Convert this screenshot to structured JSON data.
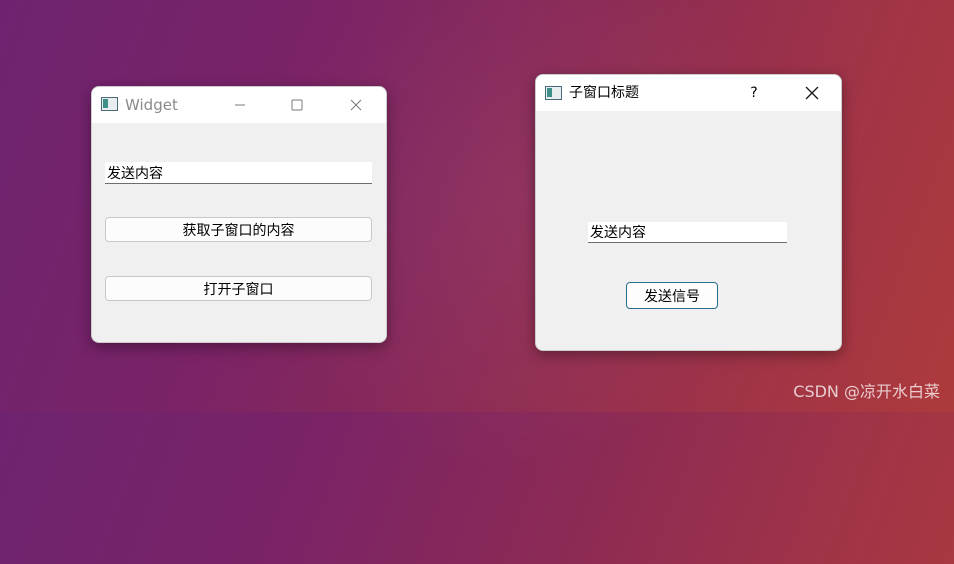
{
  "widget_window": {
    "title": "Widget",
    "line_edit_value": "发送内容",
    "get_child_button": "获取子窗口的内容",
    "open_child_button": "打开子窗口"
  },
  "child_dialog": {
    "title": "子窗口标题",
    "help_glyph": "?",
    "line_edit_value": "发送内容",
    "send_signal_button": "发送信号"
  },
  "watermark": "CSDN @凉开水白菜",
  "icons": {
    "app": "app-window-icon",
    "minimize": "minimize-icon",
    "maximize": "maximize-icon",
    "close": "close-icon",
    "help": "help-icon"
  },
  "colors": {
    "window_bg": "#f0f0f0",
    "titlebar_bg": "#ffffff",
    "default_button_border": "#2a6f8f"
  }
}
